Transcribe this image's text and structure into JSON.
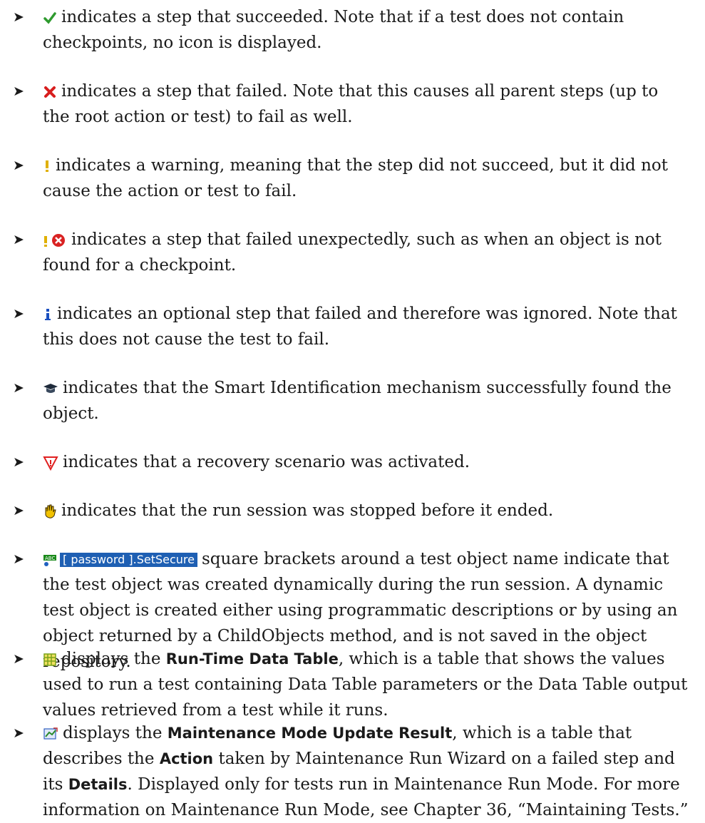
{
  "items": [
    {
      "icon": "checkmark-icon",
      "text": "indicates a step that succeeded. Note that if a test does not contain checkpoints, no icon is displayed."
    },
    {
      "icon": "cross-icon",
      "text": "indicates a step that failed. Note that this causes all parent steps (up to the root action or test) to fail as well."
    },
    {
      "icon": "warning-exclamation-icon",
      "text": "indicates a warning, meaning that the step did not succeed, but it did not cause the action or test to fail."
    },
    {
      "icon": "unexpected-failure-icon",
      "text": "indicates a step that failed unexpectedly, such as when an object is not found for a checkpoint."
    },
    {
      "icon": "info-icon",
      "text": "indicates an optional step that failed and therefore was ignored. Note that this does not cause the test to fail."
    },
    {
      "icon": "smart-identification-icon",
      "text": "indicates that the Smart Identification mechanism successfully found the object."
    },
    {
      "icon": "recovery-scenario-icon",
      "text": "indicates that a recovery scenario was activated."
    },
    {
      "icon": "stop-hand-icon",
      "text": "indicates that the run session was stopped before it ended."
    },
    {
      "icon": "edit-box-icon",
      "object_label": "[ password ].SetSecure",
      "text": "square brackets around a test object name indicate that the test object was created dynamically during the run session. A dynamic test object is created either using programmatic descriptions or by using an object returned by a ChildObjects method, and is not saved in the object repository."
    },
    {
      "icon": "data-table-icon",
      "pre": "displays the",
      "bold": "Run-Time Data Table",
      "post": ", which is a table that shows the values used to run a test containing Data Table parameters or the Data Table output values retrieved from a test while it runs."
    },
    {
      "icon": "maintenance-update-icon",
      "pre": "displays the",
      "bold": "Maintenance Mode Update Result",
      "mid": ", which is a table that describes the",
      "bold2": "Action",
      "mid2": "taken by Maintenance Run Wizard on a failed step and its",
      "bold3": "Details",
      "post": ". Displayed only for tests run in Maintenance Run Mode. For more information on Maintenance Run Mode, see Chapter 36, “Maintaining Tests.”"
    }
  ],
  "bullet": "➤"
}
